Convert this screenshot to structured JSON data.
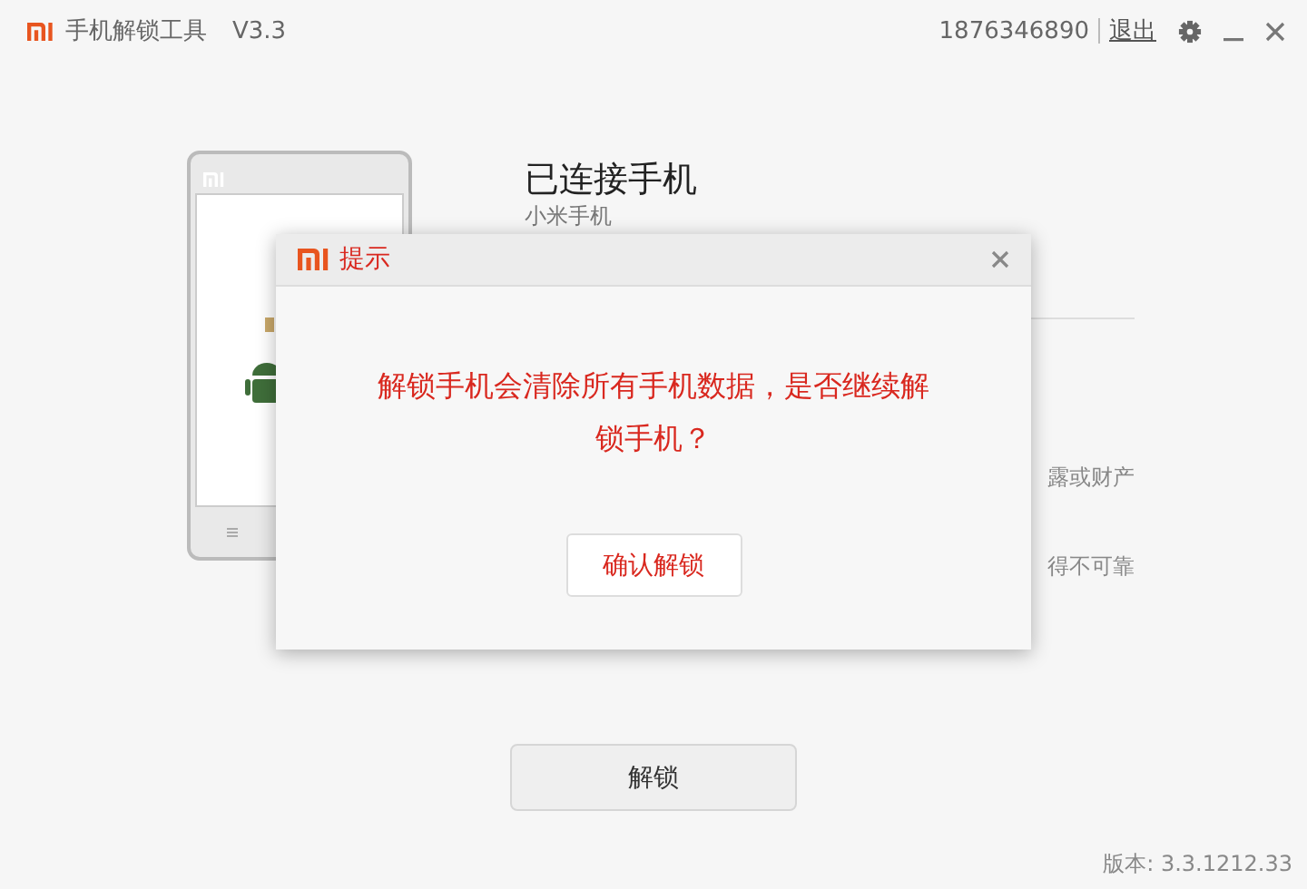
{
  "window": {
    "title": "手机解锁工具",
    "version": "V3.3"
  },
  "account": {
    "phone": "1876346890",
    "logout": "退出"
  },
  "device": {
    "heading": "已连接手机",
    "model": "小米手机",
    "notes": [
      "露或财产",
      "得不可靠"
    ]
  },
  "unlock_button": "解锁",
  "version_label": "版本: 3.3.1212.33",
  "dialog": {
    "title": "提示",
    "message": "解锁手机会清除所有手机数据，是否继续解锁手机？",
    "confirm_button": "确认解锁"
  }
}
